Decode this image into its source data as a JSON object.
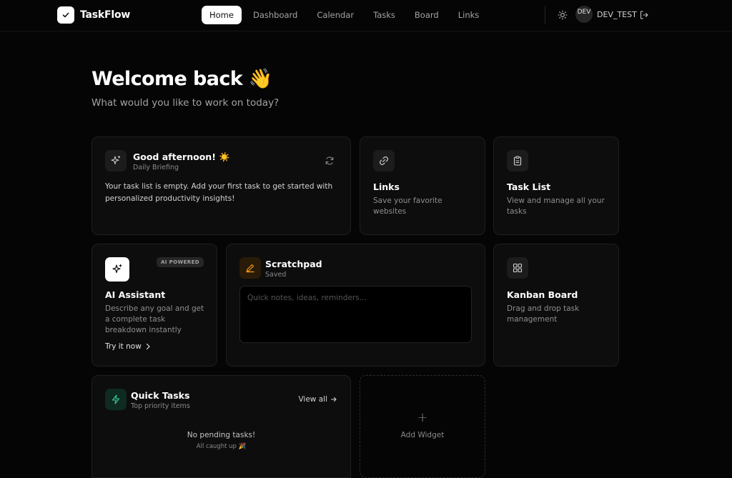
{
  "brand": {
    "name": "TaskFlow"
  },
  "nav": {
    "links": [
      "Home",
      "Dashboard",
      "Calendar",
      "Tasks",
      "Board",
      "Links"
    ],
    "active": "Home",
    "user": {
      "avatar_text": "DEV",
      "name": "DEV_TEST"
    }
  },
  "hero": {
    "title": "Welcome back 👋",
    "subtitle": "What would you like to work on today?"
  },
  "briefing": {
    "title": "Good afternoon! ☀️",
    "sub": "Daily Briefing",
    "text": "Your task list is empty. Add your first task to get started with personalized productivity insights!"
  },
  "links_card": {
    "title": "Links",
    "desc": "Save your favorite websites"
  },
  "tasklist_card": {
    "title": "Task List",
    "desc": "View and manage all your tasks"
  },
  "ai_card": {
    "badge": "AI POWERED",
    "title": "AI Assistant",
    "desc": "Describe any goal and get a complete task breakdown instantly",
    "cta": "Try it now"
  },
  "scratchpad": {
    "title": "Scratchpad",
    "status": "Saved",
    "value": "",
    "placeholder": "Quick notes, ideas, reminders..."
  },
  "kanban_card": {
    "title": "Kanban Board",
    "desc": "Drag and drop task management"
  },
  "quick_tasks": {
    "title": "Quick Tasks",
    "sub": "Top priority items",
    "view_all": "View all",
    "empty_title": "No pending tasks!",
    "empty_sub": "All caught up 🎉"
  },
  "add_widget": {
    "plus": "+",
    "label": "Add Widget"
  },
  "colors": {
    "background": "#050505",
    "card": "#0d0d0d",
    "scratchpad_accent": "#f59e0b",
    "quick_tasks_accent": "#34d399"
  }
}
